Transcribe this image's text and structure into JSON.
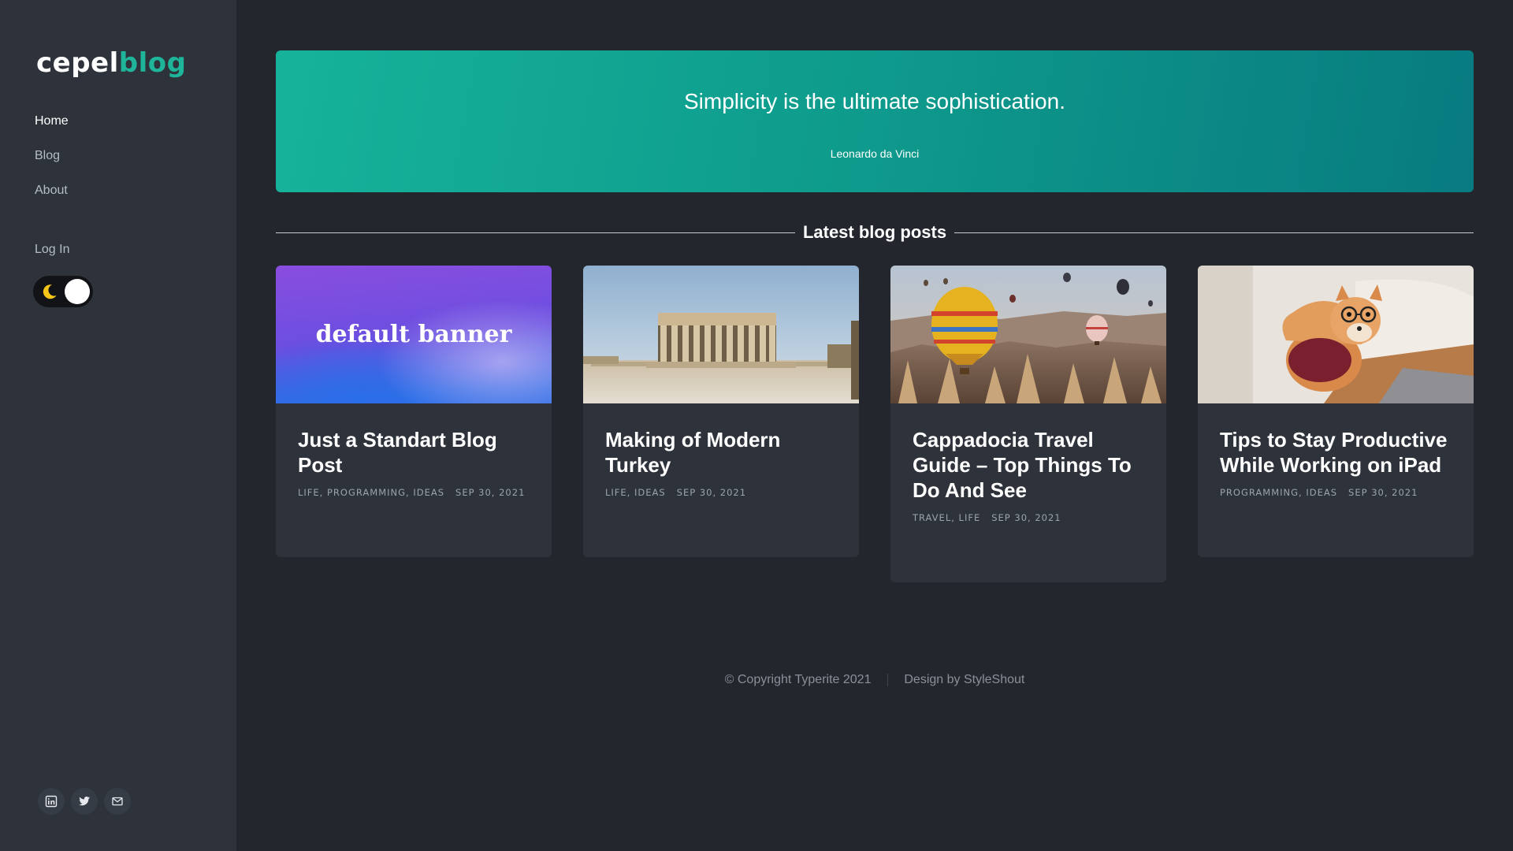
{
  "sidebar": {
    "logo_part1": "cepel",
    "logo_part2": "blog",
    "nav": [
      {
        "label": "Home",
        "active": true
      },
      {
        "label": "Blog"
      },
      {
        "label": "About"
      }
    ],
    "login_label": "Log In",
    "theme_toggle": {
      "icon": "moon-icon",
      "state": "dark"
    },
    "social": [
      "linkedin-icon",
      "twitter-icon",
      "mail-icon"
    ]
  },
  "hero": {
    "quote": "Simplicity is the ultimate sophistication.",
    "author": "Leonardo da Vinci"
  },
  "section": {
    "title": "Latest blog posts"
  },
  "posts": [
    {
      "title": "Just a Standart Blog Post",
      "banner_text": "default banner",
      "categories": "LIFE, PROGRAMMING, IDEAS",
      "date": "SEP 30, 2021"
    },
    {
      "title": "Making of Modern Turkey",
      "categories": "LIFE, IDEAS",
      "date": "SEP 30, 2021"
    },
    {
      "title": "Cappadocia Travel Guide – Top Things To Do And See",
      "categories": "TRAVEL, LIFE",
      "date": "SEP 30, 2021"
    },
    {
      "title": "Tips to Stay Productive While Working on iPad",
      "categories": "PROGRAMMING, IDEAS",
      "date": "SEP 30, 2021"
    }
  ],
  "footer": {
    "copyright": "© Copyright Typerite 2021",
    "design": "Design by StyleShout"
  },
  "colors": {
    "accent": "#1fb59a",
    "background": "#23272d",
    "sidebar": "#2e333b",
    "card": "#2e333b"
  }
}
